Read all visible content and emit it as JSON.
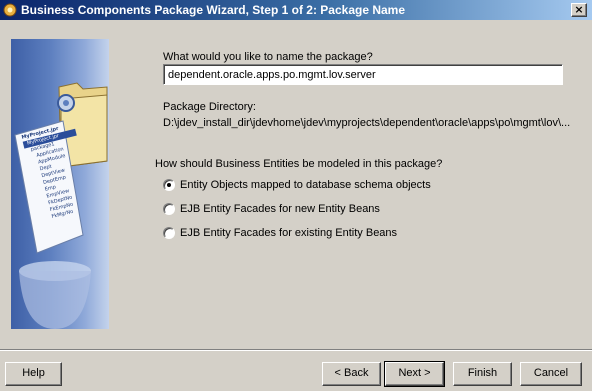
{
  "window": {
    "title": "Business Components Package Wizard, Step 1 of 2: Package Name",
    "close_glyph": "×"
  },
  "form": {
    "name_prompt": "What would you like to name the package?",
    "package_name": "dependent.oracle.apps.po.mgmt.lov.server",
    "dir_label": "Package Directory:",
    "dir_value": "D:\\jdev_install_dir\\jdevhome\\jdev\\myprojects\\dependent\\oracle\\apps\\po\\mgmt\\lov\\...",
    "model_prompt": "How should Business Entities be modeled in this package?",
    "options": [
      {
        "label": "Entity Objects mapped to database schema objects",
        "checked": true
      },
      {
        "label": "EJB Entity Facades for new Entity Beans",
        "checked": false
      },
      {
        "label": "EJB Entity Facades for existing Entity Beans",
        "checked": false
      }
    ]
  },
  "buttons": {
    "help": "Help",
    "back": "< Back",
    "next": "Next >",
    "finish": "Finish",
    "cancel": "Cancel"
  },
  "banner": {
    "tree_items": [
      "MyProject.jpr",
      "MyProject.jpr",
      "package1",
      "Application",
      "AppModule",
      "Dept",
      "DeptView",
      "DeptEmp",
      "Emp",
      "EmpView",
      "FkDeptNo",
      "FkEmpNo",
      "FkMgrNo"
    ]
  },
  "colors": {
    "titlebar_start": "#0a246a",
    "titlebar_end": "#a6caf0",
    "dialog_bg": "#d4d0c8",
    "banner_blue": "#5d7fbf"
  }
}
